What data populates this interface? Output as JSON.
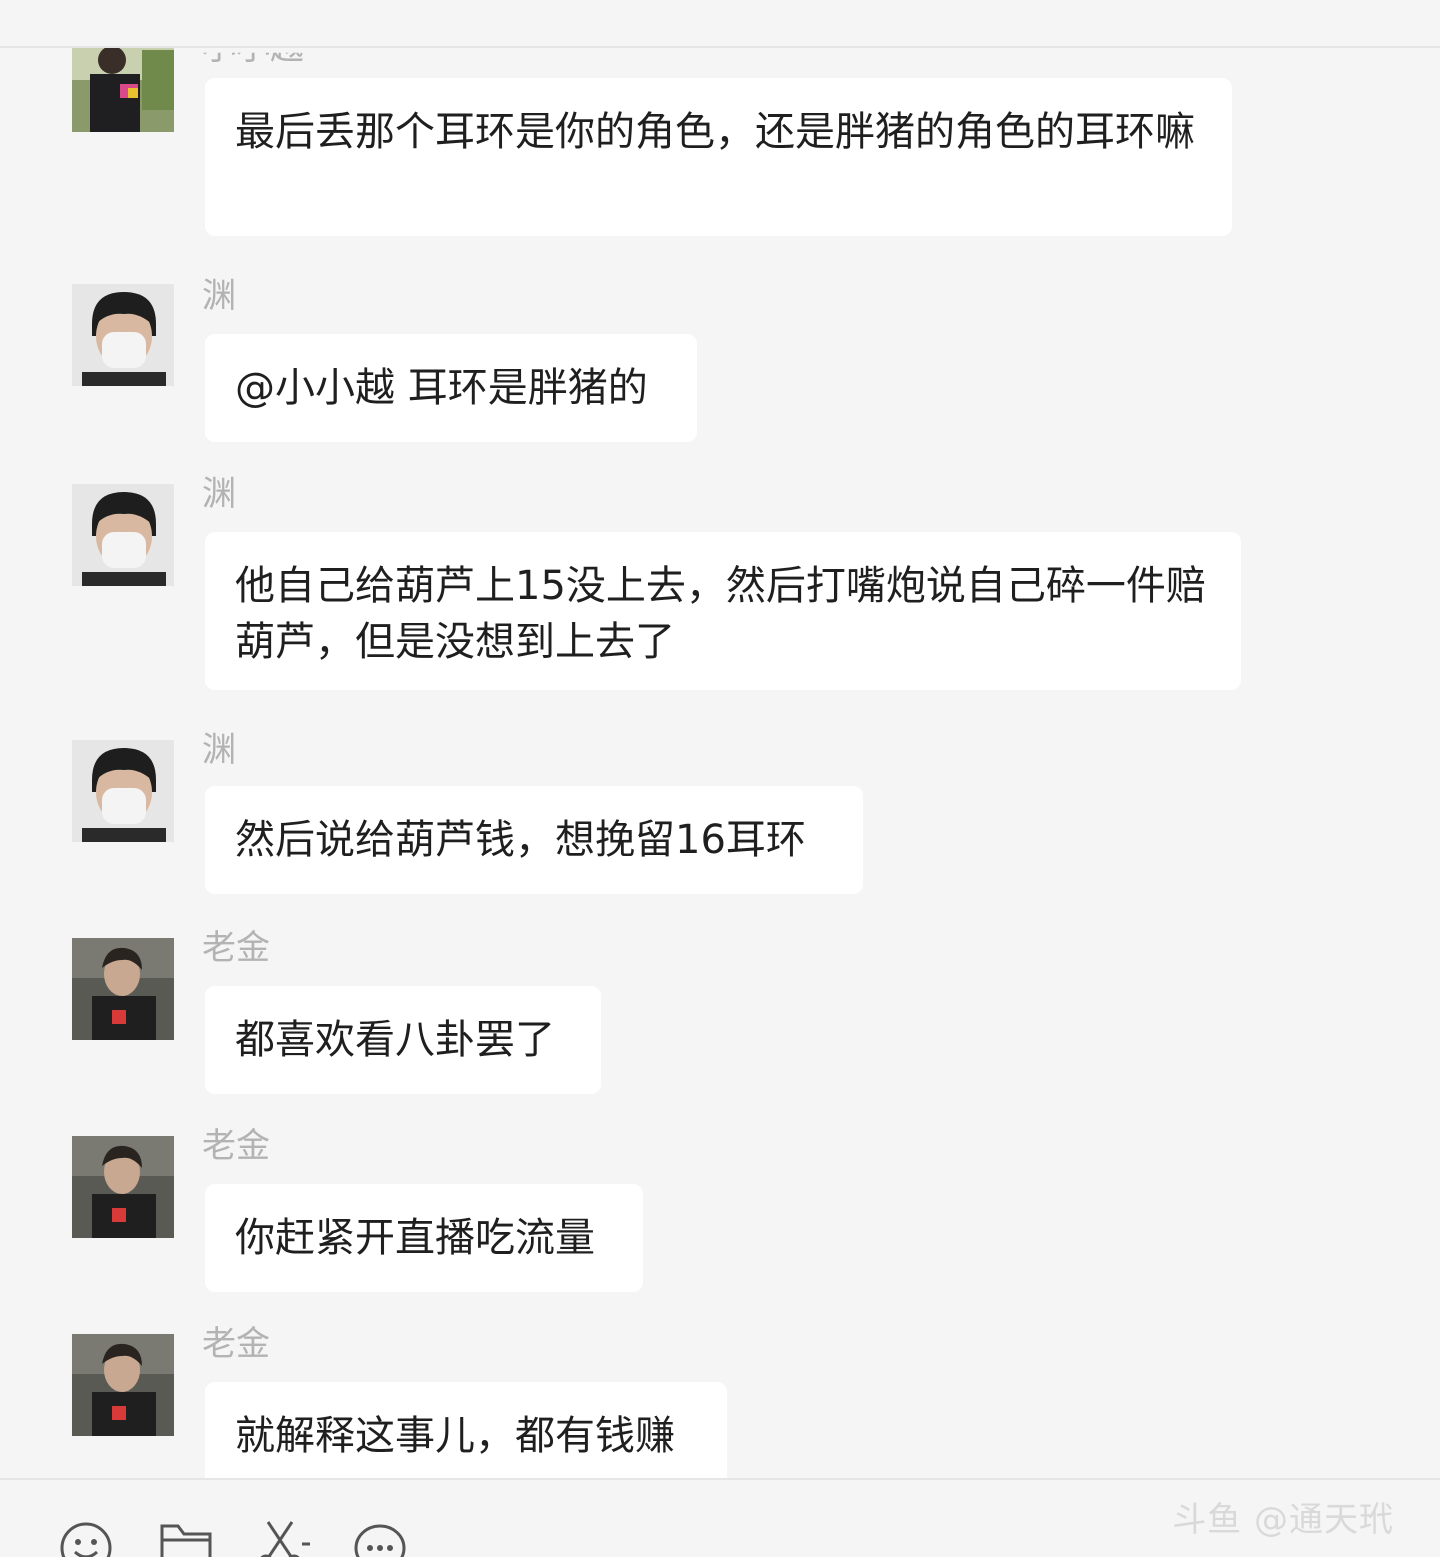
{
  "top_partial_sender": "小小越",
  "messages": [
    {
      "sender": "",
      "text": "最后丢那个耳环是你的角色，还是胖猪的角色的耳环嘛",
      "avatar": "avatar-xiaoxiaoyue"
    },
    {
      "sender": "渊",
      "text": "@小小越 耳环是胖猪的",
      "avatar": "avatar-yuan"
    },
    {
      "sender": "渊",
      "text": "他自己给葫芦上15没上去，然后打嘴炮说自己碎一件赔葫芦，但是没想到上去了",
      "avatar": "avatar-yuan"
    },
    {
      "sender": "渊",
      "text": "然后说给葫芦钱，想挽留16耳环",
      "avatar": "avatar-yuan"
    },
    {
      "sender": "老金",
      "text": "都喜欢看八卦罢了",
      "avatar": "avatar-laojin"
    },
    {
      "sender": "老金",
      "text": "你赶紧开直播吃流量",
      "avatar": "avatar-laojin"
    },
    {
      "sender": "老金",
      "text": "就解释这事儿，都有钱赚",
      "avatar": "avatar-laojin"
    }
  ],
  "toolbar": {
    "items": [
      "emoji-icon",
      "folder-icon",
      "scissors-icon",
      "chat-bubble-icon"
    ]
  },
  "watermark": "斗鱼 @通天玳",
  "colors": {
    "background": "#f5f5f5",
    "bubble": "#ffffff",
    "sender_name": "#b3b3b3",
    "text": "#1f1f1f"
  }
}
